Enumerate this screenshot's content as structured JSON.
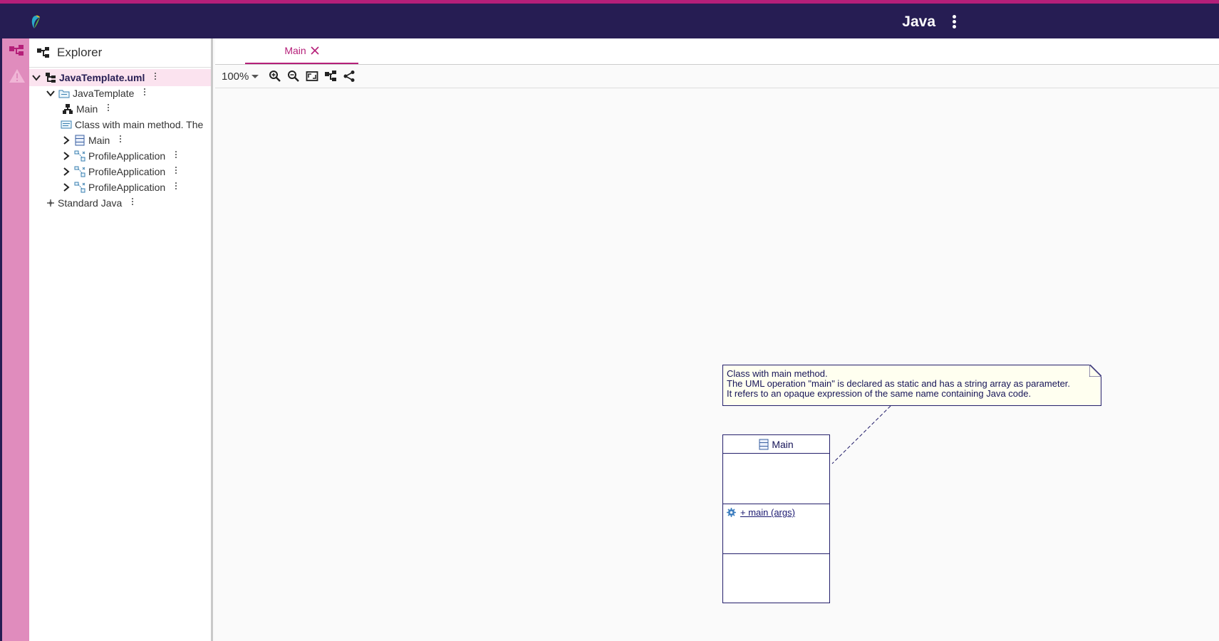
{
  "app": {
    "title": "Java",
    "logo_icon": "eclipse-papyrus-logo"
  },
  "colors": {
    "topbar": "#261d53",
    "accent": "#b51f79",
    "rail": "#e08cbd"
  },
  "rail": {
    "items": [
      {
        "icon": "tree-icon"
      },
      {
        "icon": "warning-icon"
      }
    ]
  },
  "explorer": {
    "title": "Explorer",
    "items": [
      {
        "label": "JavaTemplate.uml",
        "bold": true
      },
      {
        "label": "JavaTemplate"
      },
      {
        "label": "Main"
      },
      {
        "label": "Class with main method. The"
      },
      {
        "label": "Main"
      },
      {
        "label": "ProfileApplication"
      },
      {
        "label": "ProfileApplication"
      },
      {
        "label": "ProfileApplication"
      },
      {
        "label": "Standard Java"
      }
    ]
  },
  "editor": {
    "tab": {
      "label": "Main"
    },
    "toolbar": {
      "zoom": "100%"
    }
  },
  "diagram": {
    "note": {
      "lines": [
        "Class with main method.",
        "The UML operation \"main\" is declared as static and has a string array as parameter.",
        "It refers to an opaque expression of the same name containing Java code."
      ]
    },
    "class": {
      "name": "Main",
      "operation": "+ main (args)"
    }
  }
}
